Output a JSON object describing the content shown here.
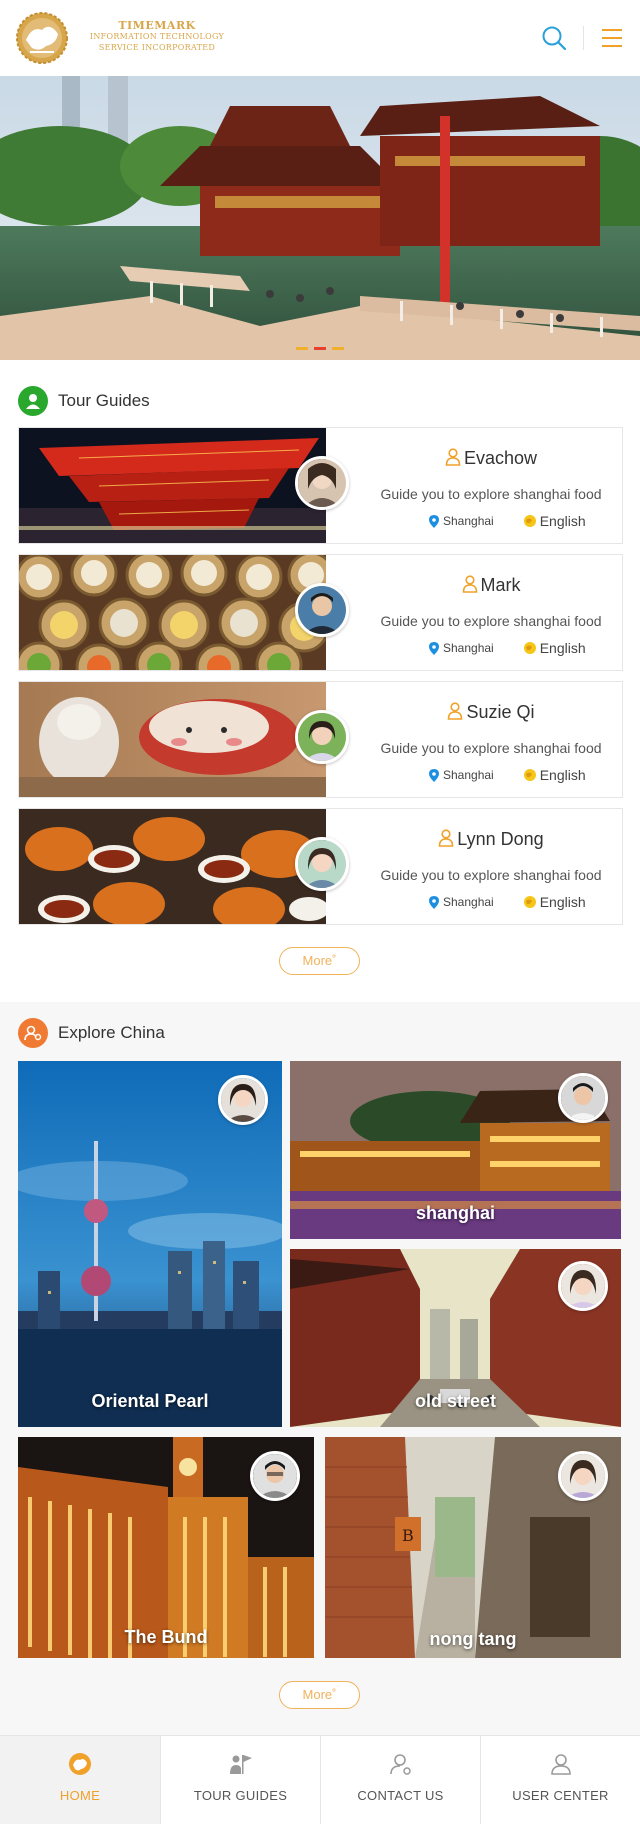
{
  "header": {
    "company_line1": "TIMEMARK",
    "company_line2": "INFORMATION TECHNOLOGY",
    "company_line3": "SERVICE INCORPORATED",
    "search_icon": "search-icon",
    "menu_icon": "menu-icon"
  },
  "banner": {
    "slide_count": 3,
    "active_index": 1
  },
  "tour_guides": {
    "title": "Tour  Guides",
    "more_label": "More",
    "guides": [
      {
        "name": "Evachow",
        "description": "Guide you to explore shanghai food",
        "city": "Shanghai",
        "language": "English"
      },
      {
        "name": "Mark",
        "description": "Guide you to explore shanghai food",
        "city": "Shanghai",
        "language": "English"
      },
      {
        "name": "Suzie Qi",
        "description": "Guide you to explore shanghai food",
        "city": "Shanghai",
        "language": "English"
      },
      {
        "name": "Lynn Dong",
        "description": "Guide you to explore shanghai food",
        "city": "Shanghai",
        "language": "English"
      }
    ]
  },
  "explore": {
    "title": "Explore China",
    "more_label": "More",
    "tiles": [
      {
        "label": "Oriental Pearl"
      },
      {
        "label": "shanghai"
      },
      {
        "label": "old street"
      },
      {
        "label": "The Bund"
      },
      {
        "label": "nong tang"
      }
    ]
  },
  "nav": {
    "items": [
      {
        "label": "HOME",
        "icon": "home-icon"
      },
      {
        "label": "TOUR  GUIDES",
        "icon": "flag-icon"
      },
      {
        "label": "CONTACT US",
        "icon": "contact-icon"
      },
      {
        "label": "USER CENTER",
        "icon": "user-icon"
      }
    ]
  },
  "colors": {
    "accent": "#f0a12a",
    "gold": "#d8a64a",
    "guides_icon": "#2aa82e",
    "explore_icon": "#f07a32",
    "search_blue": "#2aa0d8"
  }
}
